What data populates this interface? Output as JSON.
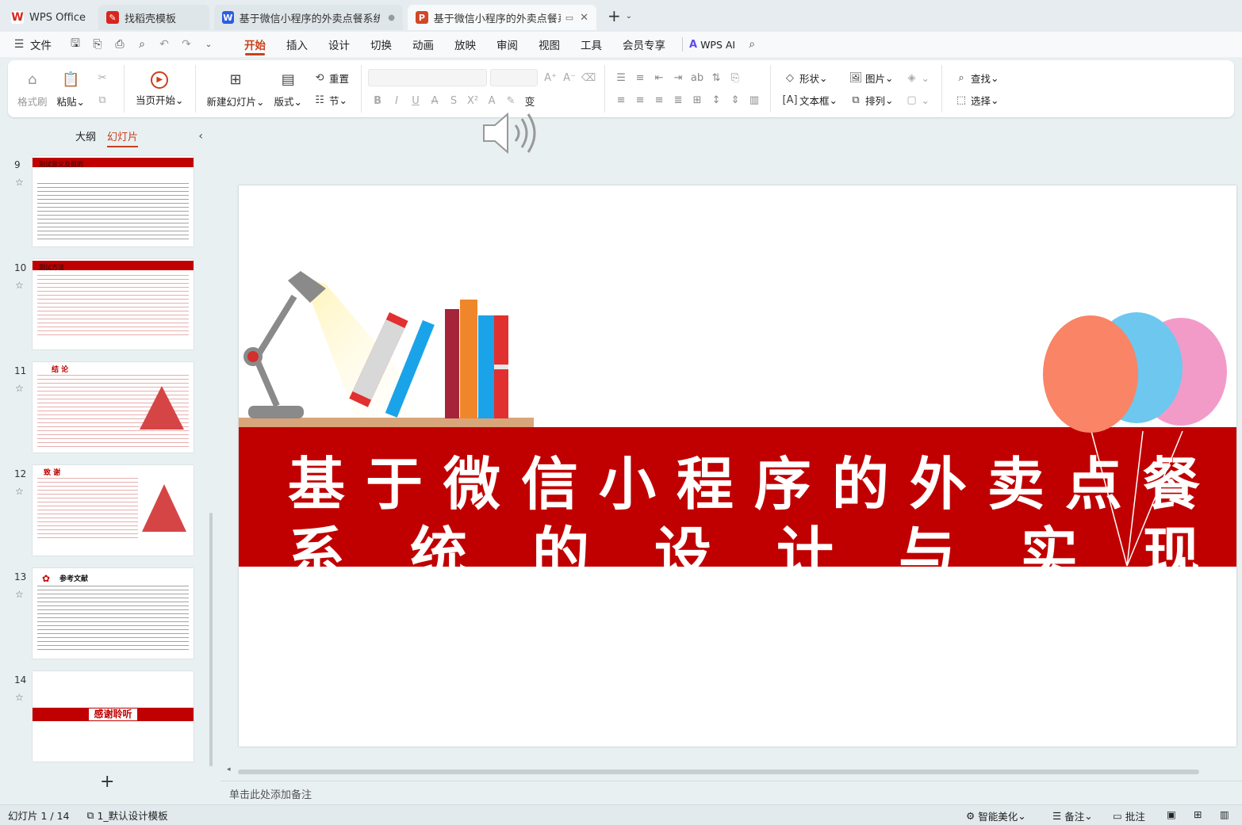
{
  "tabs": [
    {
      "label": "WPS Office",
      "icon": "wps-logo-icon"
    },
    {
      "label": "找稻壳模板",
      "icon": "docer-icon"
    },
    {
      "label": "基于微信小程序的外卖点餐系统的",
      "icon": "word-icon"
    },
    {
      "label": "基于微信小程序的外卖点餐系统",
      "icon": "ppt-icon"
    }
  ],
  "menubar": {
    "file": "文件",
    "items": [
      "开始",
      "插入",
      "设计",
      "切换",
      "动画",
      "放映",
      "审阅",
      "视图",
      "工具",
      "会员专享"
    ],
    "wps_ai": "WPS AI"
  },
  "ribbon": {
    "format_painter": "格式刷",
    "paste": "粘贴",
    "play_from_current": "当页开始",
    "new_slide": "新建幻灯片",
    "layout": "版式",
    "reset": "重置",
    "section": "节",
    "shape": "形状",
    "picture": "图片",
    "textbox": "文本框",
    "arrange": "排列",
    "find": "查找",
    "select": "选择"
  },
  "leftpanel": {
    "outline": "大纲",
    "slides": "幻灯片",
    "thumbs": [
      {
        "num": "9",
        "title": "测试意义及目的"
      },
      {
        "num": "10",
        "title": "测试方法"
      },
      {
        "num": "11",
        "title": "结  论"
      },
      {
        "num": "12",
        "title": "致  谢"
      },
      {
        "num": "13",
        "title": "参考文献"
      },
      {
        "num": "14",
        "title": "感谢聆听"
      }
    ]
  },
  "slide": {
    "title_line1": [
      "基",
      "于",
      "微",
      "信",
      "小",
      "程",
      "序",
      "的",
      "外",
      "卖",
      "点",
      "餐"
    ],
    "title_line2": [
      "系",
      "统",
      "的",
      "设",
      "计",
      "与",
      "实",
      "现"
    ]
  },
  "notes_placeholder": "单击此处添加备注",
  "statusbar": {
    "slide_count": "幻灯片 1 / 14",
    "template": "1_默认设计模板",
    "beautify": "智能美化",
    "notes": "备注",
    "comments": "批注"
  },
  "colors": {
    "accent": "#c8411d",
    "banner": "#c00000"
  }
}
